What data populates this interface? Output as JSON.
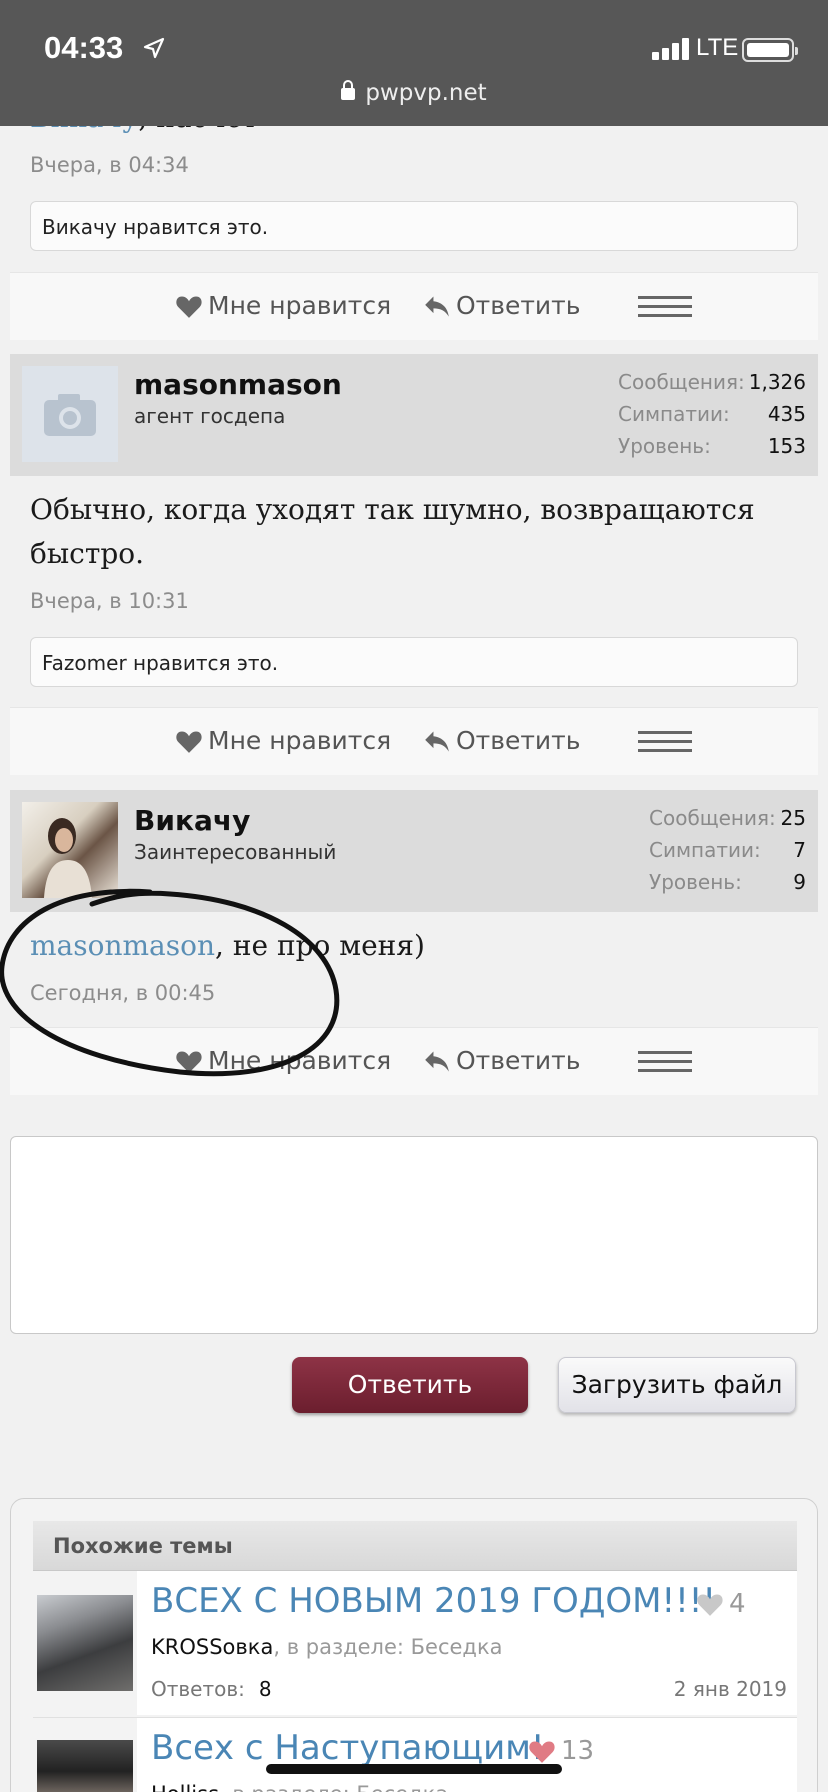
{
  "status": {
    "time": "04:33",
    "network": "LTE",
    "url": "pwpvp.net"
  },
  "top_partial": {
    "mention": "Викачу",
    "text": ", насчёт",
    "date": "Вчера, в 04:34",
    "likes": "Викачу нравится это."
  },
  "actions": {
    "like": "Мне нравится",
    "reply": "Ответить"
  },
  "posts": [
    {
      "username": "masonmason",
      "user_title": "агент госдепа",
      "stats": [
        {
          "k": "Сообщения:",
          "v": "1,326"
        },
        {
          "k": "Симпатии:",
          "v": "435"
        },
        {
          "k": "Уровень:",
          "v": "153"
        }
      ],
      "text_line1": "Обычно, когда уходят так шумно, возвращаются",
      "text_line2": "быстро.",
      "date": "Вчера, в 10:31",
      "likes": "Fazomer нравится это."
    },
    {
      "username": "Викачу",
      "user_title": "Заинтересованный",
      "stats": [
        {
          "k": "Сообщения:",
          "v": "25"
        },
        {
          "k": "Симпатии:",
          "v": "7"
        },
        {
          "k": "Уровень:",
          "v": "9"
        }
      ],
      "mention": "masonmason",
      "text": ", не про меня)",
      "date": "Сегодня, в 00:45"
    }
  ],
  "editor": {
    "reply_button": "Ответить",
    "upload_button": "Загрузить файл"
  },
  "similar": {
    "heading": "Похожие темы",
    "threads": [
      {
        "title": "ВСЕХ С НОВЫМ 2019 ГОДОМ!!!!",
        "likes": "4",
        "author": "KROSSовка",
        "section": ", в разделе: Беседка",
        "replies_label": "Ответов:",
        "replies": "8",
        "date": "2 янв 2019"
      },
      {
        "title": "Всех с Наступающим!",
        "likes": "13",
        "author": "Holliss",
        "section": ", в разделе: Беседка"
      }
    ]
  },
  "colors": {
    "accent_button": "#7a2638",
    "link": "#4a86b5",
    "like_heart_active": "#e07b84"
  }
}
